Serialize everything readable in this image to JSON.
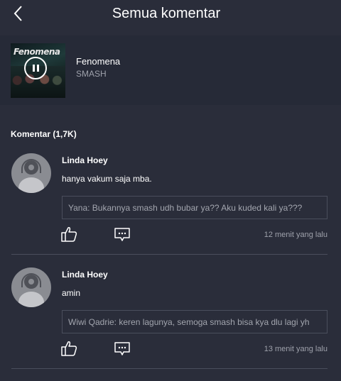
{
  "header": {
    "title": "Semua komentar",
    "back_icon": "chevron-left-icon"
  },
  "now_playing": {
    "cover_text": "Fenomena",
    "title": "Fenomena",
    "artist": "SMASH",
    "state_icon": "pause-icon"
  },
  "comments_section": {
    "title": "Komentar (1,7K)"
  },
  "comments": [
    {
      "name": "Linda Hoey",
      "text": "hanya vakum saja mba.",
      "reply": "Yana: Bukannya smash udh bubar ya?? Aku kuded kali ya???",
      "time": "12 menit yang lalu"
    },
    {
      "name": "Linda Hoey",
      "text": "amin",
      "reply": "Wiwi Qadrie: keren lagunya, semoga smash bisa kya dlu lagi yh",
      "time": "13 menit yang lalu"
    }
  ],
  "colors": {
    "background": "#2a2d3a",
    "now_playing_bg": "#262a37",
    "muted_text": "#9ea1ab",
    "divider": "#4a4e5c"
  }
}
